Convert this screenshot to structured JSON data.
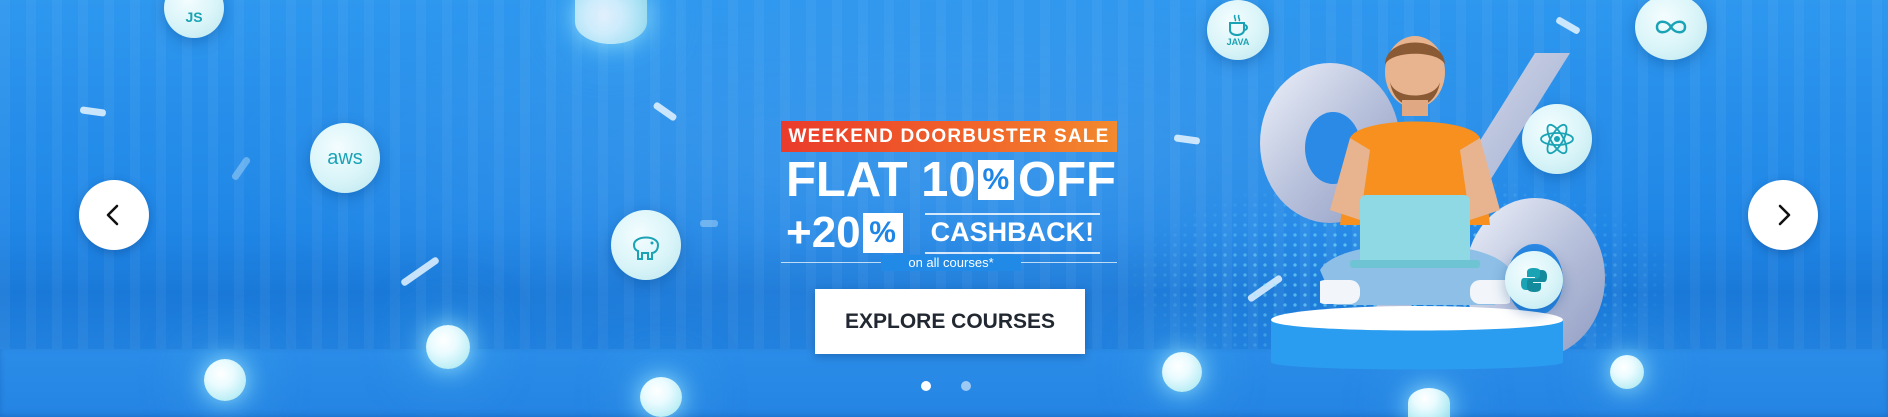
{
  "promo": {
    "sale_tag": "WEEKEND DOORBUSTER SALE",
    "flat_label": "FLAT 10",
    "percent_symbol": "%",
    "off_label": "OFF",
    "plus_label": "+20",
    "cashback_label": "CASHBACK!",
    "footnote": "on all courses*",
    "cta_label": "EXPLORE COURSES"
  },
  "badges": {
    "js": "JS",
    "aws": "aws",
    "java": "JAVA"
  },
  "carousel": {
    "total_slides": 2,
    "active_slide": 1
  },
  "colors": {
    "background": "#1f86e6",
    "sale_tag_start": "#ea3b2b",
    "sale_tag_end": "#f28a2e",
    "cta_text": "#222831",
    "tshirt": "#f7901e",
    "orb_glow": "#bfeff6"
  },
  "icons": {
    "prev": "chevron-left-icon",
    "next": "chevron-right-icon"
  }
}
